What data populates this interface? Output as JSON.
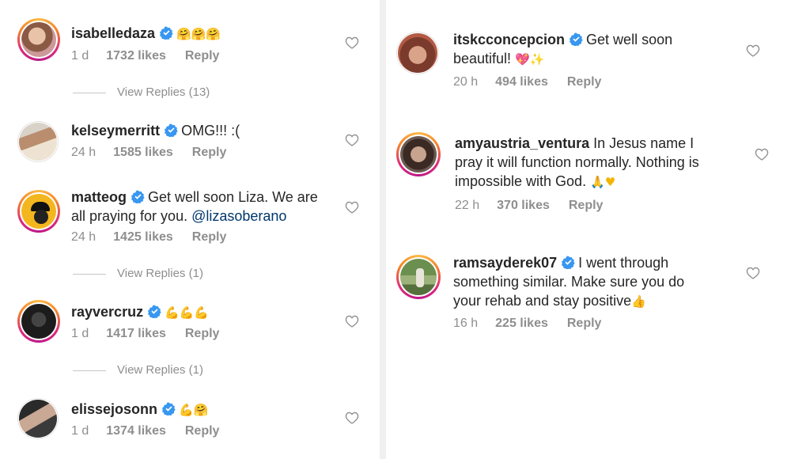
{
  "left": {
    "comments": [
      {
        "username": "isabelledaza",
        "text": "",
        "emoji": "🤗🤗🤗",
        "time": "1 d",
        "likes": "1732 likes",
        "reply": "Reply"
      },
      {
        "username": "kelseymerritt",
        "text": "OMG!!! :(",
        "time": "24 h",
        "likes": "1585 likes",
        "reply": "Reply"
      },
      {
        "username": "matteog",
        "text_line1": "Get well soon Liza. We are",
        "text_line2": "all praying for you.",
        "mention": "@lizasoberano",
        "time": "24 h",
        "likes": "1425 likes",
        "reply": "Reply"
      },
      {
        "username": "rayvercruz",
        "emoji": "💪💪💪",
        "time": "1 d",
        "likes": "1417 likes",
        "reply": "Reply"
      },
      {
        "username": "elissejosonn",
        "emoji": "💪🤗",
        "time": "1 d",
        "likes": "1374 likes",
        "reply": "Reply"
      }
    ],
    "view_replies": [
      "View Replies (13)",
      "View Replies (1)",
      "View Replies (1)"
    ]
  },
  "right": {
    "comments": [
      {
        "username": "itskcconcepcion",
        "text_line1": "Get well soon",
        "text_line2": "beautiful!",
        "emoji": "💖✨",
        "time": "20 h",
        "likes": "494 likes",
        "reply": "Reply"
      },
      {
        "username": "amyaustria_ventura",
        "text_line1": "In Jesus name I",
        "text_line2": "pray it will function normally. Nothing is",
        "text_line3": "impossible with God.",
        "emoji": "🙏♥",
        "time": "22 h",
        "likes": "370 likes",
        "reply": "Reply"
      },
      {
        "username": "ramsayderek07",
        "text_line1": "I went through",
        "text_line2": "something similar. Make sure you do",
        "text_line3": "your rehab and stay positive",
        "emoji": "👍",
        "time": "16 h",
        "likes": "225 likes",
        "reply": "Reply"
      }
    ]
  },
  "colors": {
    "verified": "#3897f0",
    "meta": "#8e8e8e",
    "mention": "#00376b",
    "heart": "#8e8e8e"
  }
}
